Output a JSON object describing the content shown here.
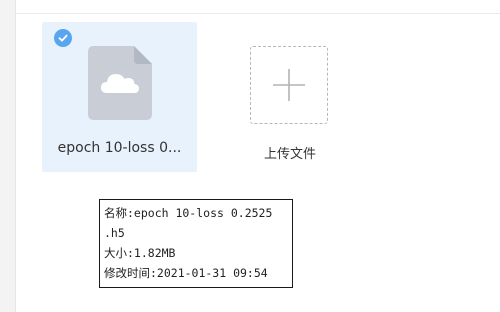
{
  "file_card": {
    "file_name": "epoch 10-loss 0...",
    "selected": true,
    "icon": "cloud-file-icon",
    "check_icon": "check-circle-icon"
  },
  "upload": {
    "label": "上传文件",
    "icon": "plus-icon"
  },
  "tooltip": {
    "name_line": "名称:epoch 10-loss 0.2525",
    "name_line_cont": ".h5",
    "size_line": "大小:1.82MB",
    "modified_line": "修改时间:2021-01-31 09:54"
  },
  "colors": {
    "card_background": "#e8f2fd",
    "check_badge": "#5aa6ee",
    "file_icon": "#c9ced6"
  }
}
